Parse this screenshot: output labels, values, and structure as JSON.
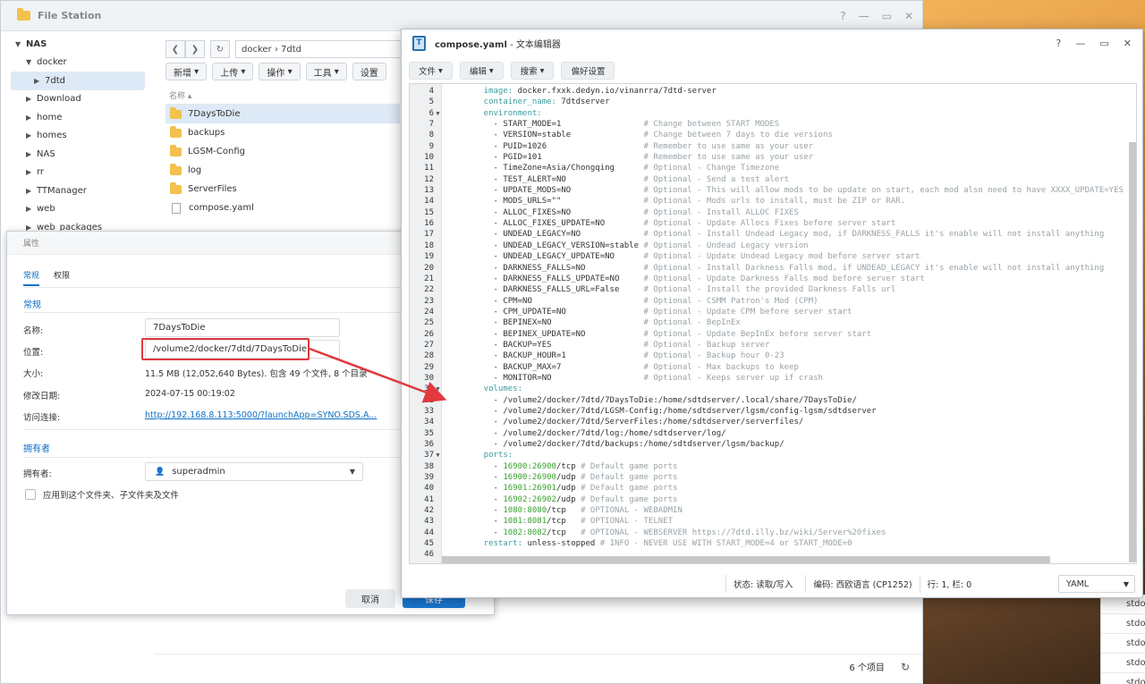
{
  "fileStation": {
    "title": "File Station",
    "tree": [
      {
        "label": "NAS",
        "level": 0,
        "open": true
      },
      {
        "label": "docker",
        "level": 1,
        "open": true
      },
      {
        "label": "7dtd",
        "level": 2,
        "selected": true
      },
      {
        "label": "Download",
        "level": 1
      },
      {
        "label": "home",
        "level": 1
      },
      {
        "label": "homes",
        "level": 1
      },
      {
        "label": "NAS",
        "level": 1
      },
      {
        "label": "rr",
        "level": 1
      },
      {
        "label": "TTManager",
        "level": 1
      },
      {
        "label": "web",
        "level": 1
      },
      {
        "label": "web_packages",
        "level": 1
      }
    ],
    "breadcrumb": "docker › 7dtd",
    "toolbar": {
      "new": "新增",
      "upload": "上传",
      "action": "操作",
      "tools": "工具",
      "settings": "设置"
    },
    "column_name": "名称 ▴",
    "files": [
      {
        "name": "7DaysToDie",
        "type": "folder",
        "selected": true
      },
      {
        "name": "backups",
        "type": "folder"
      },
      {
        "name": "LGSM-Config",
        "type": "folder"
      },
      {
        "name": "log",
        "type": "folder"
      },
      {
        "name": "ServerFiles",
        "type": "folder"
      },
      {
        "name": "compose.yaml",
        "type": "file"
      }
    ],
    "item_count": "6 个项目",
    "bg_rows": [
      "stdo",
      "stdo",
      "stdo",
      "stdo",
      "stdo"
    ]
  },
  "properties": {
    "title": "属性",
    "tabs": [
      "常规",
      "权限"
    ],
    "section_general": "常规",
    "name_label": "名称:",
    "name_value": "7DaysToDie",
    "location_label": "位置:",
    "location_value": "/volume2/docker/7dtd/7DaysToDie",
    "size_label": "大小:",
    "size_value": "11.5 MB (12,052,640 Bytes). 包含 49 个文件, 8 个目录",
    "modified_label": "修改日期:",
    "modified_value": "2024-07-15 00:19:02",
    "link_label": "访问连接:",
    "link_value": "http://192.168.8.113:5000/?launchApp=SYNO.SDS.A...",
    "section_owner": "拥有者",
    "owner_label": "拥有者:",
    "owner_value": "superadmin",
    "apply_label": "应用到这个文件夹、子文件夹及文件",
    "cancel": "取消",
    "ok": "保存"
  },
  "editor": {
    "filename": "compose.yaml",
    "app_suffix": " - 文本编辑器",
    "menu": [
      "文件",
      "编辑",
      "搜索",
      "偏好设置"
    ],
    "status_mode": "状态: 读取/写入",
    "status_encoding": "编码: 西欧语言 (CP1252)",
    "status_pos": "行: 1, 栏: 0",
    "syntax": "YAML",
    "lines": [
      {
        "n": "4",
        "parts": [
          [
            "k",
            "    image: "
          ],
          [
            "s",
            "docker.fxxk.dedyn.io/vinanrra/7dtd-server"
          ]
        ]
      },
      {
        "n": "5",
        "parts": [
          [
            "k",
            "    container_name: "
          ],
          [
            "s",
            "7dtdserver"
          ]
        ]
      },
      {
        "n": "6",
        "fold": true,
        "parts": [
          [
            "k",
            "    environment:"
          ]
        ]
      },
      {
        "n": "7",
        "parts": [
          [
            "s",
            "      - START_MODE=1                 "
          ],
          [
            "c",
            "# Change between START MODES"
          ]
        ]
      },
      {
        "n": "8",
        "parts": [
          [
            "s",
            "      - VERSION=stable               "
          ],
          [
            "c",
            "# Change between 7 days to die versions"
          ]
        ]
      },
      {
        "n": "9",
        "parts": [
          [
            "s",
            "      - PUID=1026                    "
          ],
          [
            "c",
            "# Remember to use same as your user"
          ]
        ]
      },
      {
        "n": "10",
        "parts": [
          [
            "s",
            "      - PGID=101                     "
          ],
          [
            "c",
            "# Remember to use same as your user"
          ]
        ]
      },
      {
        "n": "11",
        "parts": [
          [
            "s",
            "      - TimeZone=Asia/Chongqing      "
          ],
          [
            "c",
            "# Optional - Change Timezone"
          ]
        ]
      },
      {
        "n": "12",
        "parts": [
          [
            "s",
            "      - TEST_ALERT=NO                "
          ],
          [
            "c",
            "# Optional - Send a test alert"
          ]
        ]
      },
      {
        "n": "13",
        "parts": [
          [
            "s",
            "      - UPDATE_MODS=NO               "
          ],
          [
            "c",
            "# Optional - This will allow mods to be update on start, each mod also need to have XXXX_UPDATE=YES to update on start"
          ]
        ]
      },
      {
        "n": "14",
        "parts": [
          [
            "s",
            "      - MODS_URLS=\"\"                 "
          ],
          [
            "c",
            "# Optional - Mods urls to install, must be ZIP or RAR."
          ]
        ]
      },
      {
        "n": "15",
        "parts": [
          [
            "s",
            "      - ALLOC_FIXES=NO               "
          ],
          [
            "c",
            "# Optional - Install ALLOC FIXES"
          ]
        ]
      },
      {
        "n": "16",
        "parts": [
          [
            "s",
            "      - ALLOC_FIXES_UPDATE=NO        "
          ],
          [
            "c",
            "# Optional - Update Allocs Fixes before server start"
          ]
        ]
      },
      {
        "n": "17",
        "parts": [
          [
            "s",
            "      - UNDEAD_LEGACY=NO             "
          ],
          [
            "c",
            "# Optional - Install Undead Legacy mod, if DARKNESS_FALLS it's enable will not install anything"
          ]
        ]
      },
      {
        "n": "18",
        "parts": [
          [
            "s",
            "      - UNDEAD_LEGACY_VERSION=stable "
          ],
          [
            "c",
            "# Optional - Undead Legacy version"
          ]
        ]
      },
      {
        "n": "19",
        "parts": [
          [
            "s",
            "      - UNDEAD_LEGACY_UPDATE=NO      "
          ],
          [
            "c",
            "# Optional - Update Undead Legacy mod before server start"
          ]
        ]
      },
      {
        "n": "20",
        "parts": [
          [
            "s",
            "      - DARKNESS_FALLS=NO            "
          ],
          [
            "c",
            "# Optional - Install Darkness Falls mod, if UNDEAD_LEGACY it's enable will not install anything"
          ]
        ]
      },
      {
        "n": "21",
        "parts": [
          [
            "s",
            "      - DARKNESS_FALLS_UPDATE=NO     "
          ],
          [
            "c",
            "# Optional - Update Darkness Falls mod before server start"
          ]
        ]
      },
      {
        "n": "22",
        "parts": [
          [
            "s",
            "      - DARKNESS_FALLS_URL=False     "
          ],
          [
            "c",
            "# Optional - Install the provided Darkness Falls url"
          ]
        ]
      },
      {
        "n": "23",
        "parts": [
          [
            "s",
            "      - CPM=NO                       "
          ],
          [
            "c",
            "# Optional - CSMM Patron's Mod (CPM)"
          ]
        ]
      },
      {
        "n": "24",
        "parts": [
          [
            "s",
            "      - CPM_UPDATE=NO                "
          ],
          [
            "c",
            "# Optional - Update CPM before server start"
          ]
        ]
      },
      {
        "n": "25",
        "parts": [
          [
            "s",
            "      - BEPINEX=NO                   "
          ],
          [
            "c",
            "# Optional - BepInEx"
          ]
        ]
      },
      {
        "n": "26",
        "parts": [
          [
            "s",
            "      - BEPINEX_UPDATE=NO            "
          ],
          [
            "c",
            "# Optional - Update BepInEx before server start"
          ]
        ]
      },
      {
        "n": "27",
        "parts": [
          [
            "s",
            "      - BACKUP=YES                   "
          ],
          [
            "c",
            "# Optional - Backup server"
          ]
        ]
      },
      {
        "n": "28",
        "parts": [
          [
            "s",
            "      - BACKUP_HOUR=1                "
          ],
          [
            "c",
            "# Optional - Backup hour 0-23"
          ]
        ]
      },
      {
        "n": "29",
        "parts": [
          [
            "s",
            "      - BACKUP_MAX=7                 "
          ],
          [
            "c",
            "# Optional - Max backups to keep"
          ]
        ]
      },
      {
        "n": "30",
        "parts": [
          [
            "s",
            "      - MONITOR=NO                   "
          ],
          [
            "c",
            "# Optional - Keeps server up if crash"
          ]
        ]
      },
      {
        "n": "31",
        "fold": true,
        "parts": [
          [
            "k",
            "    volumes:"
          ]
        ]
      },
      {
        "n": "32",
        "parts": [
          [
            "s",
            "      - /volume2/docker/7dtd/7DaysToDie:/home/sdtdserver/.local/share/7DaysToDie/"
          ]
        ]
      },
      {
        "n": "33",
        "parts": [
          [
            "s",
            "      - /volume2/docker/7dtd/LGSM-Config:/home/sdtdserver/lgsm/config-lgsm/sdtdserver"
          ]
        ]
      },
      {
        "n": "34",
        "parts": [
          [
            "s",
            "      - /volume2/docker/7dtd/ServerFiles:/home/sdtdserver/serverfiles/"
          ]
        ]
      },
      {
        "n": "35",
        "parts": [
          [
            "s",
            "      - /volume2/docker/7dtd/log:/home/sdtdserver/log/"
          ]
        ]
      },
      {
        "n": "36",
        "parts": [
          [
            "s",
            "      - /volume2/docker/7dtd/backups:/home/sdtdserver/lgsm/backup/"
          ]
        ]
      },
      {
        "n": "37",
        "fold": true,
        "parts": [
          [
            "k",
            "    ports:"
          ]
        ]
      },
      {
        "n": "38",
        "parts": [
          [
            "s",
            "      - "
          ],
          [
            "n",
            "16900:26900"
          ],
          [
            "s",
            "/tcp "
          ],
          [
            "c",
            "# Default game ports"
          ]
        ]
      },
      {
        "n": "39",
        "parts": [
          [
            "s",
            "      - "
          ],
          [
            "n",
            "16900:26900"
          ],
          [
            "s",
            "/udp "
          ],
          [
            "c",
            "# Default game ports"
          ]
        ]
      },
      {
        "n": "40",
        "parts": [
          [
            "s",
            "      - "
          ],
          [
            "n",
            "16901:26901"
          ],
          [
            "s",
            "/udp "
          ],
          [
            "c",
            "# Default game ports"
          ]
        ]
      },
      {
        "n": "41",
        "parts": [
          [
            "s",
            "      - "
          ],
          [
            "n",
            "16902:26902"
          ],
          [
            "s",
            "/udp "
          ],
          [
            "c",
            "# Default game ports"
          ]
        ]
      },
      {
        "n": "42",
        "parts": [
          [
            "s",
            "      - "
          ],
          [
            "n",
            "1080:8080"
          ],
          [
            "s",
            "/tcp   "
          ],
          [
            "c",
            "# OPTIONAL - WEBADMIN"
          ]
        ]
      },
      {
        "n": "43",
        "parts": [
          [
            "s",
            "      - "
          ],
          [
            "n",
            "1081:8081"
          ],
          [
            "s",
            "/tcp   "
          ],
          [
            "c",
            "# OPTIONAL - TELNET"
          ]
        ]
      },
      {
        "n": "44",
        "parts": [
          [
            "s",
            "      - "
          ],
          [
            "n",
            "1082:8082"
          ],
          [
            "s",
            "/tcp   "
          ],
          [
            "c",
            "# OPTIONAL - WEBSERVER https://7dtd.illy.bz/wiki/Server%20fixes"
          ]
        ]
      },
      {
        "n": "45",
        "parts": [
          [
            "k",
            "    restart: "
          ],
          [
            "s",
            "unless-stopped "
          ],
          [
            "c",
            "# INFO - NEVER USE WITH START_MODE=4 or START_MODE=0"
          ]
        ]
      },
      {
        "n": "46",
        "parts": []
      }
    ]
  },
  "colors": {
    "accent": "#0a6ec8",
    "highlight": "#e0393e",
    "key": "#3a9b9b",
    "comment": "#9aa3a8",
    "number": "#3aa12f"
  }
}
